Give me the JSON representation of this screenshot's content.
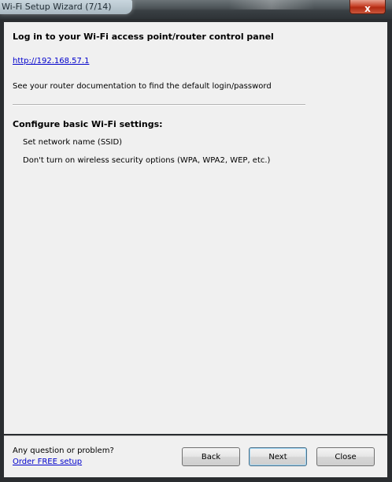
{
  "window": {
    "title": "Wi-Fi Setup Wizard (7/14)",
    "close_glyph": "x"
  },
  "step": {
    "heading": "Log in to your Wi-Fi access point/router control panel",
    "router_link": "http://192.168.57.1",
    "doc_hint": "See your router documentation to find the default login/password",
    "settings_heading": "Configure basic Wi-Fi settings:",
    "settings_items": [
      "Set network name (SSID)",
      "Don't turn on wireless security options (WPA, WPA2, WEP, etc.)"
    ]
  },
  "footer": {
    "question": "Any question or problem?",
    "order_link": "Order FREE setup",
    "back_label": "Back",
    "next_label": "Next",
    "close_label": "Close"
  },
  "colors": {
    "link": "#0000cc",
    "close_button": "#c7432a",
    "panel_background": "#f0f0f0",
    "frame": "#2a2d30"
  }
}
